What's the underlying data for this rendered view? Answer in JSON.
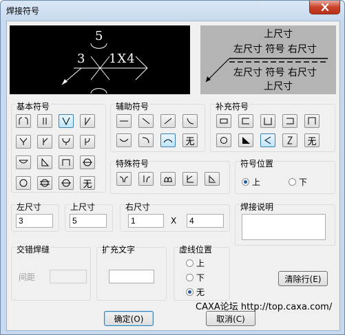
{
  "window": {
    "title": "焊接符号"
  },
  "preview_symbol": {
    "top_value": "5",
    "left_value": "3",
    "right_value": "1X4"
  },
  "preview_legend": {
    "upper_top": "上尺寸",
    "upper_row": "左尺寸 符号 右尺寸",
    "lower_row": "左尺寸 符号 右尺寸",
    "lower_bottom": "上尺寸"
  },
  "groups": {
    "basic": "基本符号",
    "auxiliary": "辅助符号",
    "supplementary": "补充符号",
    "special": "特殊符号",
    "symbol_position": "符号位置",
    "left_size": "左尺寸",
    "top_size": "上尺寸",
    "right_size": "右尺寸",
    "weld_note": "焊接说明",
    "staggered": "交错焊缝",
    "extend_text": "扩充文字",
    "dashed_position": "虚线位置"
  },
  "none_label": "无",
  "symbol_position": {
    "up": "上",
    "down": "下",
    "selected": "up"
  },
  "dimensions": {
    "left": "3",
    "top": "5",
    "right_a": "1",
    "times": "X",
    "right_b": "4"
  },
  "staggered": {
    "spacing_label": "间距",
    "spacing_value": ""
  },
  "extend_text_value": "",
  "weld_note_value": "",
  "dashed_position": {
    "up": "上",
    "down": "下",
    "none": "无",
    "selected": "none"
  },
  "buttons": {
    "clear_row": "清除行(E)",
    "ok": "确定(O)",
    "cancel": "取消(C)"
  },
  "watermark": "CAXA论坛 http://top.caxa.com/",
  "colors": {
    "preview_bg": "#000000",
    "preview_fg": "#ffffff",
    "legend_bg": "#b4b4b4",
    "selection": "#3c7fb1"
  }
}
